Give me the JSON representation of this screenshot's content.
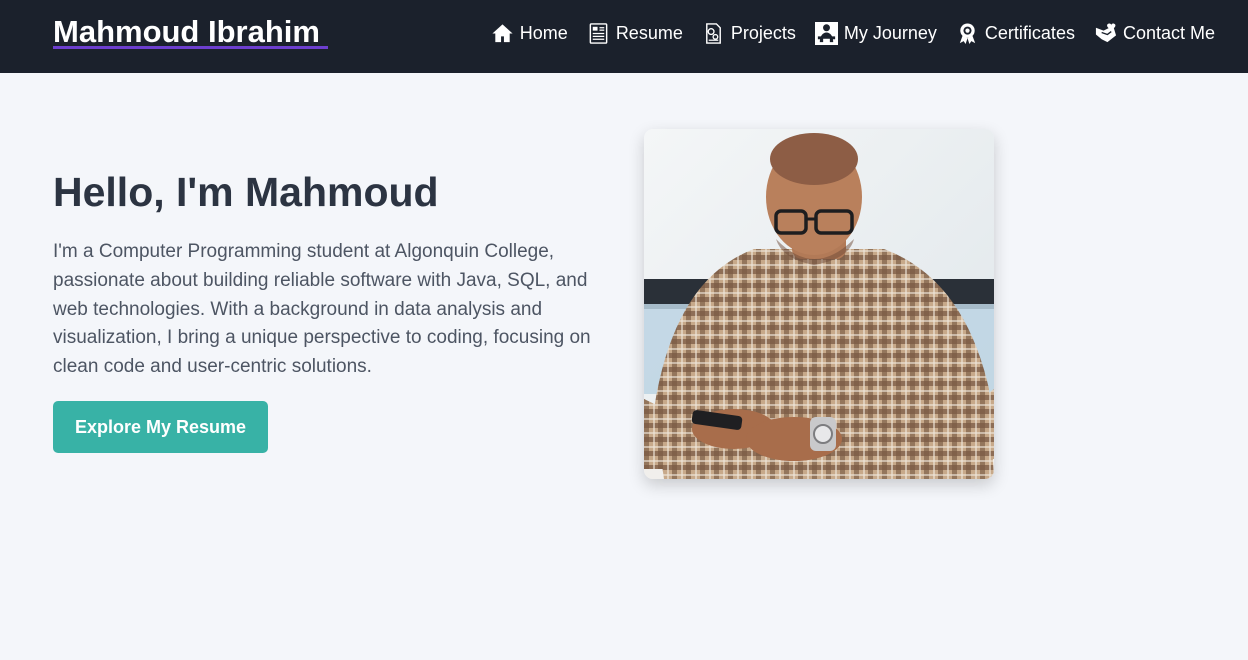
{
  "header": {
    "brand": "Mahmoud Ibrahim",
    "nav": [
      {
        "label": "Home",
        "icon": "home-icon"
      },
      {
        "label": "Resume",
        "icon": "resume-icon"
      },
      {
        "label": "Projects",
        "icon": "projects-icon"
      },
      {
        "label": "My Journey",
        "icon": "journey-icon"
      },
      {
        "label": "Certificates",
        "icon": "certificate-icon"
      },
      {
        "label": "Contact Me",
        "icon": "contact-icon"
      }
    ]
  },
  "hero": {
    "title": "Hello, I'm Mahmoud",
    "description": "I'm a Computer Programming student at Algonquin College, passionate about building reliable software with Java, SQL, and web technologies. With a background in data analysis and visualization, I bring a unique perspective to coding, focusing on clean code and user-centric solutions.",
    "cta_label": "Explore My Resume"
  },
  "colors": {
    "navbar": "#1b212c",
    "background": "#f4f6fa",
    "accent": "#38b2a6",
    "brand_underline": "#6d3fcf",
    "heading": "#2c3442",
    "body_text": "#4d5563"
  }
}
